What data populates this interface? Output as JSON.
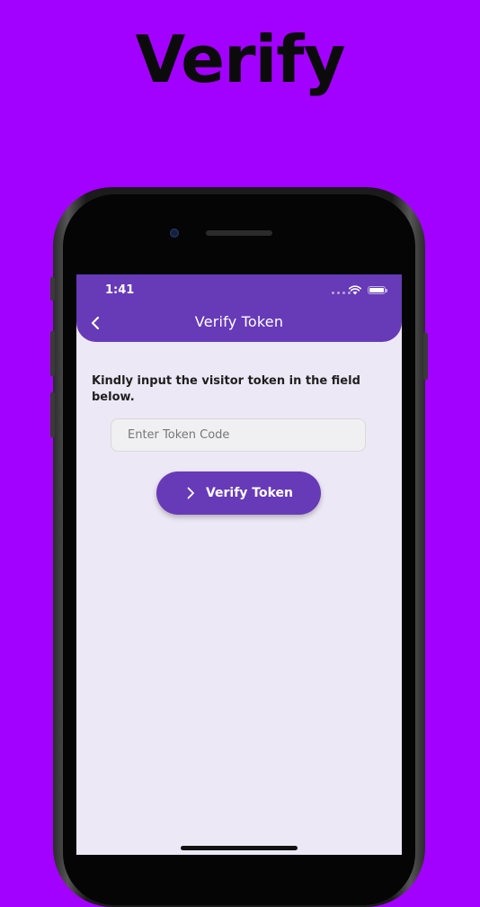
{
  "hero": {
    "title": "Verify"
  },
  "status_bar": {
    "time": "1:41"
  },
  "header": {
    "title": "Verify Token",
    "back_icon": "chevron-left-icon"
  },
  "main": {
    "instruction": "Kindly input the visitor token in the field below.",
    "token_input": {
      "value": "",
      "placeholder": "Enter Token Code"
    },
    "verify_button": {
      "label": "Verify Token",
      "icon": "chevron-right-icon"
    }
  },
  "colors": {
    "background": "#a200ff",
    "accent": "#673ab7",
    "screen_background": "#ede8f5"
  }
}
